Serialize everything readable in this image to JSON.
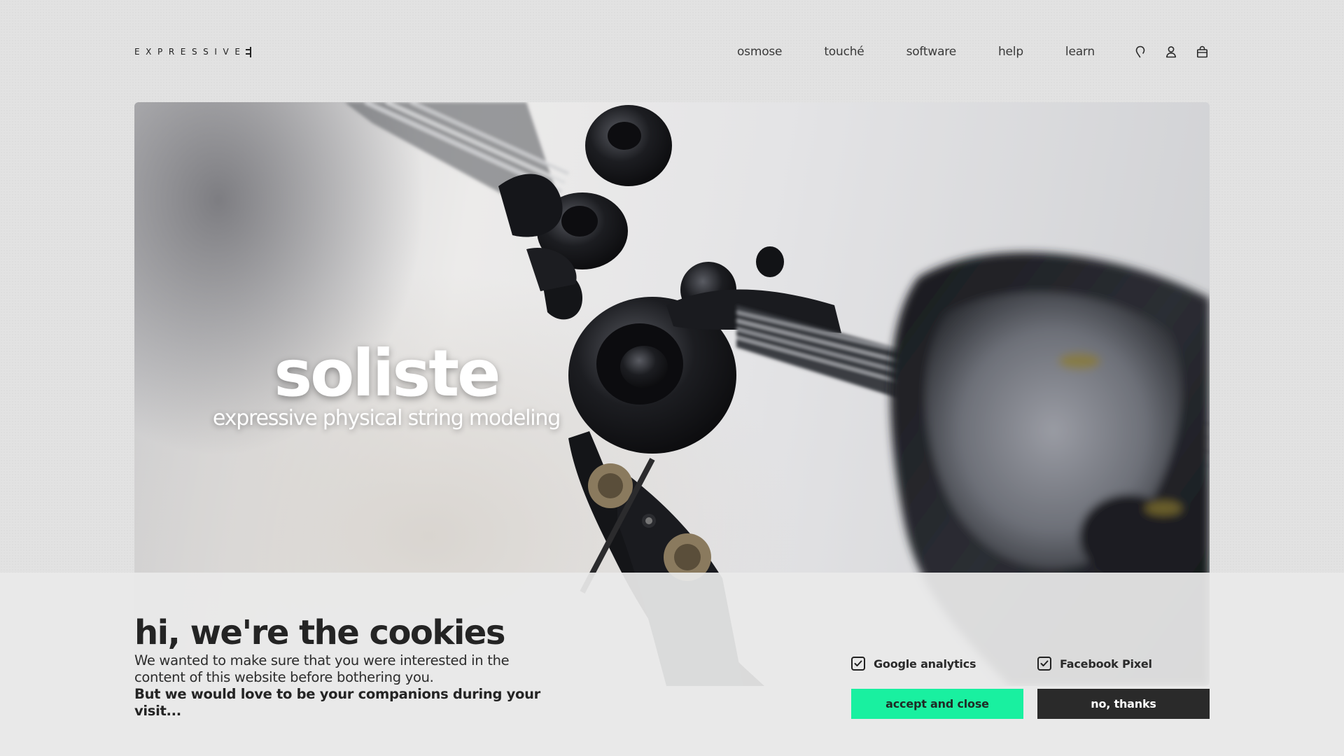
{
  "header": {
    "logo_text": "EXPRESSIVE",
    "nav": [
      "osmose",
      "touché",
      "software",
      "help",
      "learn"
    ],
    "icons": [
      "location-pin-icon",
      "user-icon",
      "bag-icon"
    ]
  },
  "hero": {
    "title": "soliste",
    "subtitle": "expressive physical string modeling"
  },
  "cookie": {
    "title": "hi, we're the cookies",
    "body": "We wanted to make sure that you were interested in the content of this website before bothering you.",
    "strong": "But we would love to be your companions during your visit...",
    "options": [
      {
        "label": "Google analytics",
        "checked": true
      },
      {
        "label": "Facebook Pixel",
        "checked": true
      }
    ],
    "accept_label": "accept and close",
    "decline_label": "no, thanks"
  },
  "colors": {
    "accent": "#19f0a0",
    "dark_button": "#2a2a2a",
    "banner_bg": "#e9e9ea"
  }
}
